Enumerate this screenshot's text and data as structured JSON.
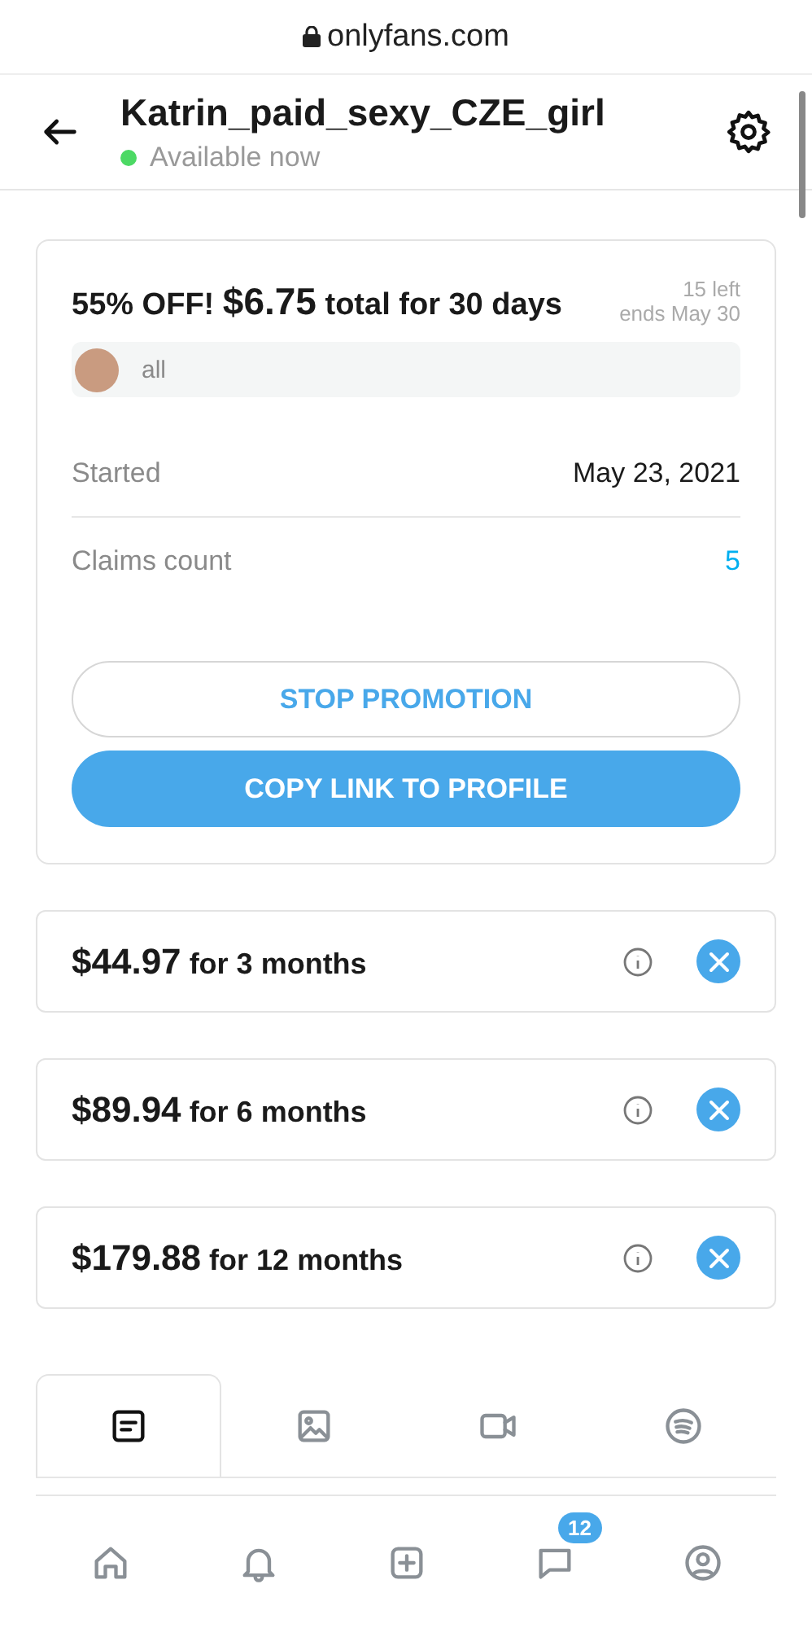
{
  "browser": {
    "url": "onlyfans.com"
  },
  "header": {
    "title": "Katrin_paid_sexy_CZE_girl",
    "status": "Available now",
    "online": true
  },
  "promotion": {
    "discount": "55% OFF!",
    "price": "$6.75",
    "terms": "total for 30 days",
    "left": "15 left",
    "ends": "ends May 30",
    "audience": "all",
    "rows": [
      {
        "label": "Started",
        "value": "May 23, 2021",
        "kind": "plain"
      },
      {
        "label": "Claims count",
        "value": "5",
        "kind": "link"
      }
    ],
    "buttons": [
      {
        "label": "STOP PROMOTION",
        "kind": "outline"
      },
      {
        "label": "COPY LINK TO PROFILE",
        "kind": "filled"
      }
    ]
  },
  "bundles": [
    {
      "price": "$44.97",
      "term": "for 3 months"
    },
    {
      "price": "$89.94",
      "term": "for 6 months"
    },
    {
      "price": "$179.88",
      "term": "for 12 months"
    }
  ],
  "tabs": [
    {
      "kind": "posts",
      "selected": true
    },
    {
      "kind": "photos",
      "selected": false
    },
    {
      "kind": "videos",
      "selected": false
    },
    {
      "kind": "audio",
      "selected": false
    }
  ],
  "nav": [
    {
      "kind": "home"
    },
    {
      "kind": "notifications"
    },
    {
      "kind": "add"
    },
    {
      "kind": "messages",
      "badge": "12"
    },
    {
      "kind": "profile"
    }
  ]
}
